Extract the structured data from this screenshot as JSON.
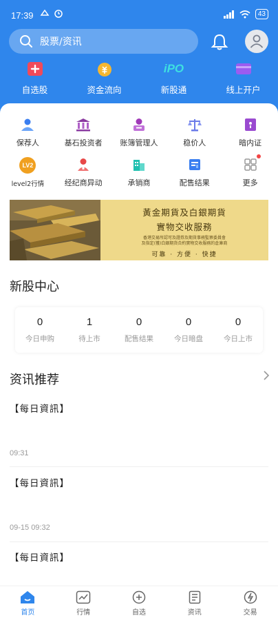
{
  "status": {
    "time": "17:39",
    "battery": "43"
  },
  "search": {
    "placeholder": "股票/资讯"
  },
  "quicknav": [
    {
      "label": "自选股",
      "icon": "plus-square-icon",
      "color": "#f04a5a"
    },
    {
      "label": "资金流向",
      "icon": "money-bag-icon",
      "color": "#f5b731"
    },
    {
      "label": "新股通",
      "icon": "ipo-text-icon",
      "color": "#3ee0e0",
      "text": "iPO"
    },
    {
      "label": "线上开户",
      "icon": "card-icon",
      "color": "#9b5cf0"
    }
  ],
  "grid": [
    {
      "label": "保荐人",
      "icon": "people-icon",
      "color": "#3a7ef0"
    },
    {
      "label": "基石投资者",
      "icon": "bank-icon",
      "color": "#8a3aa0"
    },
    {
      "label": "账簿管理人",
      "icon": "person-card-icon",
      "color": "#a03ab8"
    },
    {
      "label": "稳价人",
      "icon": "scale-icon",
      "color": "#6a7ae8"
    },
    {
      "label": "暗内证",
      "icon": "bookmark-icon",
      "color": "#9a4ad0"
    },
    {
      "label": "level2行情",
      "icon": "lv2-badge-icon",
      "color": "#f0a020",
      "text": "LV2"
    },
    {
      "label": "经纪商异动",
      "icon": "broker-icon",
      "color": "#e84848"
    },
    {
      "label": "承销商",
      "icon": "building-icon",
      "color": "#20c0b0"
    },
    {
      "label": "配售结果",
      "icon": "document-icon",
      "color": "#3a7ef0"
    },
    {
      "label": "更多",
      "icon": "grid-more-icon",
      "color": "#999999",
      "badge": true
    }
  ],
  "banner": {
    "title": "黃金期貨及白銀期貨",
    "subtitle": "實物交收服務",
    "small1": "香港交易所認可及證券及期貨事務監察委員會",
    "small2": "及指定(獲)白銀期貨合約實物交收服務的倉庫商",
    "bottom": "可靠 · 方便 · 快捷"
  },
  "ipo_center": {
    "title": "新股中心",
    "stats": [
      {
        "value": "0",
        "label": "今日申购"
      },
      {
        "value": "1",
        "label": "待上市"
      },
      {
        "value": "0",
        "label": "配售结果"
      },
      {
        "value": "0",
        "label": "今日暗盘"
      },
      {
        "value": "0",
        "label": "今日上市"
      }
    ]
  },
  "news": {
    "title": "资讯推荐",
    "items": [
      {
        "title": "【每日資訊】",
        "time": "09:31"
      },
      {
        "title": "【每日資訊】",
        "time": "09-15 09:32"
      },
      {
        "title": "【每日資訊】",
        "time": ""
      }
    ]
  },
  "tabbar": [
    {
      "label": "首页",
      "icon": "home-icon",
      "active": true
    },
    {
      "label": "行情",
      "icon": "chart-icon",
      "active": false
    },
    {
      "label": "自选",
      "icon": "add-circle-icon",
      "active": false
    },
    {
      "label": "资讯",
      "icon": "news-icon",
      "active": false
    },
    {
      "label": "交易",
      "icon": "trade-icon",
      "active": false
    }
  ],
  "colors": {
    "primary": "#2f86ec",
    "muted_text": "#999999"
  }
}
